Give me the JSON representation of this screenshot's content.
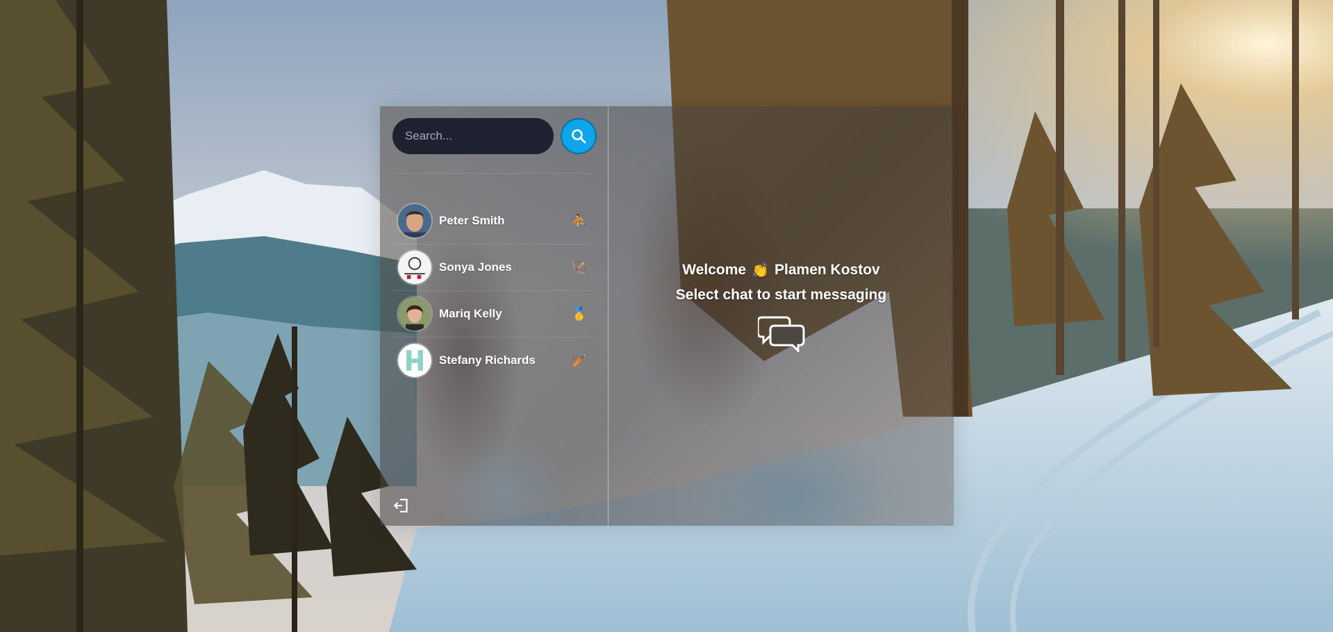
{
  "search": {
    "placeholder": "Search..."
  },
  "users": [
    {
      "name": "Peter Smith",
      "emoji": "⛹"
    },
    {
      "name": "Sonya Jones",
      "emoji": "🏹"
    },
    {
      "name": "Mariq Kelly",
      "emoji": "🥇"
    },
    {
      "name": "Stefany Richards",
      "emoji": "🏏"
    }
  ],
  "welcome": {
    "prefix": "Welcome",
    "emoji": "👏",
    "user": "Plamen Kostov",
    "prompt": "Select chat to start messaging"
  },
  "icons": {
    "search": "search-icon",
    "logout": "logout-icon",
    "chat": "chat-bubbles-icon"
  },
  "colors": {
    "accent": "#0ea5e9",
    "search_bg": "#1e2230"
  }
}
